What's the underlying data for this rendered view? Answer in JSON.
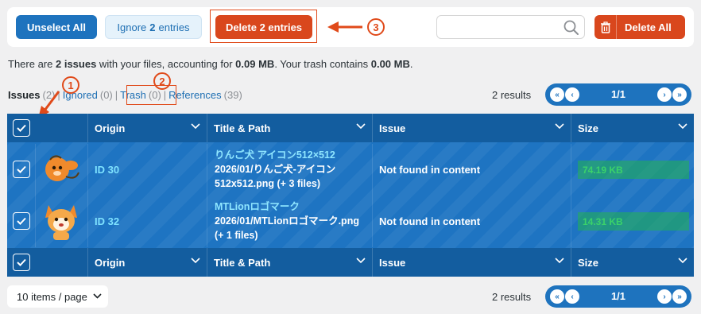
{
  "toolbar": {
    "unselect_label": "Unselect All",
    "ignore_prefix": "Ignore",
    "ignore_count": "2",
    "ignore_suffix": "entries",
    "delete_label": "Delete 2 entries",
    "search_placeholder": "",
    "delete_all_label": "Delete All"
  },
  "summary": {
    "p1": "There are ",
    "issues": "2 issues",
    "p2": " with your files, accounting for ",
    "size": "0.09 MB",
    "p3": ". Your trash contains ",
    "trash": "0.00 MB",
    "p4": "."
  },
  "tabs": [
    {
      "label": "Issues",
      "count": "(2)"
    },
    {
      "label": "Ignored",
      "count": "(0)"
    },
    {
      "label": "Trash",
      "count": "(0)"
    },
    {
      "label": "References",
      "count": "(39)"
    }
  ],
  "pagination": {
    "results_text": "2 results",
    "page_label": "1/1",
    "first": "«",
    "prev": "‹",
    "next": "›",
    "last": "»"
  },
  "table": {
    "columns": [
      "Origin",
      "Title & Path",
      "Issue",
      "Size"
    ],
    "rows": [
      {
        "origin": "ID 30",
        "title": "りんご犬 アイコン512×512",
        "path": "2026/01/りんご犬-アイコン512x512.png (+ 3 files)",
        "issue": "Not found in content",
        "size": "74.19 KB"
      },
      {
        "origin": "ID 32",
        "title": "MTLionロゴマーク",
        "path": "2026/01/MTLionロゴマーク.png (+ 1 files)",
        "issue": "Not found in content",
        "size": "14.31 KB"
      }
    ]
  },
  "footer": {
    "per_page": "10 items / page"
  },
  "annotations": {
    "n1": "1",
    "n2": "2",
    "n3": "3",
    "accent": "#e04a1a"
  },
  "colors": {
    "primary": "#1e73be",
    "danger": "#d9471d",
    "table_bg": "#1e74c2",
    "size_ok": "#22b44f"
  }
}
